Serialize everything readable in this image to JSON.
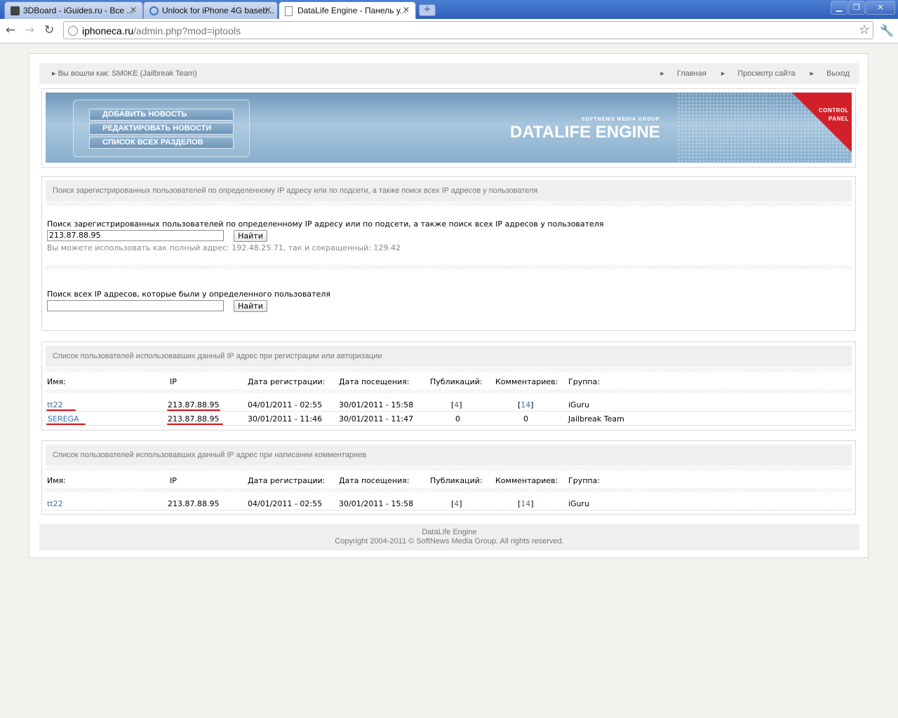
{
  "browser": {
    "tabs": [
      {
        "title": "3DBoard - iGuides.ru - Все ..."
      },
      {
        "title": "Unlock for iPhone 4G baseb..."
      },
      {
        "title": "DataLife Engine - Панель у..."
      }
    ],
    "url_host": "iphoneca.ru",
    "url_path": "/admin.php?mod=iptools"
  },
  "header": {
    "login_text": "Вы вошли как: SM0KE (Jailbreak Team)",
    "links": [
      "Главная",
      "Просмотр сайта",
      "Выход"
    ]
  },
  "banner": {
    "menu": [
      "ДОБАВИТЬ НОВОСТЬ",
      "РЕДАКТИРОВАТЬ НОВОСТИ",
      "СПИСОК ВСЕХ РАЗДЕЛОВ"
    ],
    "brand_small": "SOFTNEWS MEDIA GROUP",
    "brand": "DATALIFE ENGINE",
    "corner_line1": "CONTROL",
    "corner_line2": "PANEL"
  },
  "search": {
    "heading": "Поиск зарегистрированных пользователей по определенному IP адресу или по подсети, а также поиск всех IP адресов у пользователя",
    "ip_label": "Поиск зарегистрированных пользователей по определенному IP адресу или по подсети, а также поиск всех IP адресов у пользователя",
    "ip_value": "213.87.88.95",
    "button": "Найти",
    "hint": "Вы можете использовать как полный адрес: 192.48.25.71, так и сокращенный: 129.42",
    "user_label": "Поиск всех IP адресов, которые были у определенного пользователя",
    "user_value": ""
  },
  "columns": [
    "Имя:",
    "IP",
    "Дата регистрации:",
    "Дата посещения:",
    "Публикаций:",
    "Комментариев:",
    "Группа:"
  ],
  "reg_table": {
    "heading": "Список пользователей использовавших данный IP адрес при регистрации или авторизации",
    "rows": [
      {
        "name": "tt22",
        "ip": "213.87.88.95",
        "reg": "04/01/2011 - 02:55",
        "visit": "30/01/2011 - 15:58",
        "pubs": "4",
        "comments": "14",
        "group": "iGuru"
      },
      {
        "name": "SEREGA",
        "ip": "213.87.88.95",
        "reg": "30/01/2011 - 11:46",
        "visit": "30/01/2011 - 11:47",
        "pubs": "0",
        "comments": "0",
        "group": "Jailbreak Team"
      }
    ]
  },
  "comment_table": {
    "heading": "Список пользователей использовавших данный IP адрес при написании комментариев",
    "rows": [
      {
        "name": "tt22",
        "ip": "213.87.88.95",
        "reg": "04/01/2011 - 02:55",
        "visit": "30/01/2011 - 15:58",
        "pubs": "4",
        "comments": "14",
        "group": "iGuru"
      }
    ]
  },
  "footer": {
    "line1": "DataLife Engine",
    "line2": "Copyright 2004-2011 © SoftNews Media Group. All rights reserved."
  },
  "colors": {
    "annotation_red": "#d8121a",
    "link": "#3a6ea5",
    "banner_red": "#d2202a"
  }
}
